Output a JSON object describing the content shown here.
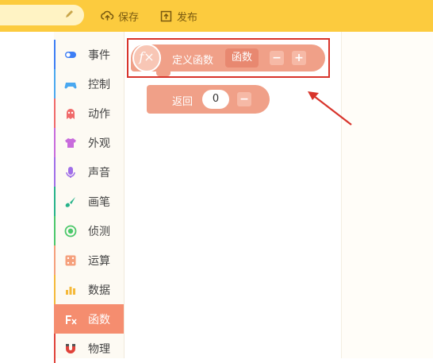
{
  "toolbar": {
    "save_label": "保存",
    "publish_label": "发布",
    "background_color": "#fccb3e"
  },
  "sidebar": {
    "items": [
      {
        "label": "事件",
        "icon": "toggle-icon",
        "color": "#3d7ef5"
      },
      {
        "label": "控制",
        "icon": "gamepad-icon",
        "color": "#4aa8f0"
      },
      {
        "label": "动作",
        "icon": "ghost-icon",
        "color": "#f06a6a"
      },
      {
        "label": "外观",
        "icon": "shirt-icon",
        "color": "#c86bdc"
      },
      {
        "label": "声音",
        "icon": "microphone-icon",
        "color": "#a06ee8"
      },
      {
        "label": "画笔",
        "icon": "brush-icon",
        "color": "#27b38a"
      },
      {
        "label": "侦测",
        "icon": "target-icon",
        "color": "#4cc86b"
      },
      {
        "label": "运算",
        "icon": "dice-icon",
        "color": "#f5a07c"
      },
      {
        "label": "数据",
        "icon": "bar-chart-icon",
        "color": "#f5b93a"
      },
      {
        "label": "函数",
        "icon": "fx-icon",
        "color": "#ffffff",
        "active": true
      },
      {
        "label": "物理",
        "icon": "magnet-icon",
        "color": "#e0423a"
      }
    ]
  },
  "workspace": {
    "define_block": {
      "icon_text": "f×",
      "label": "定义函数",
      "function_name": "函数",
      "minus": "−",
      "plus": "+"
    },
    "return_block": {
      "label": "返回",
      "value": "0",
      "minus": "−"
    },
    "accent_color": "#f0a088",
    "highlight_color": "#d8342b"
  }
}
